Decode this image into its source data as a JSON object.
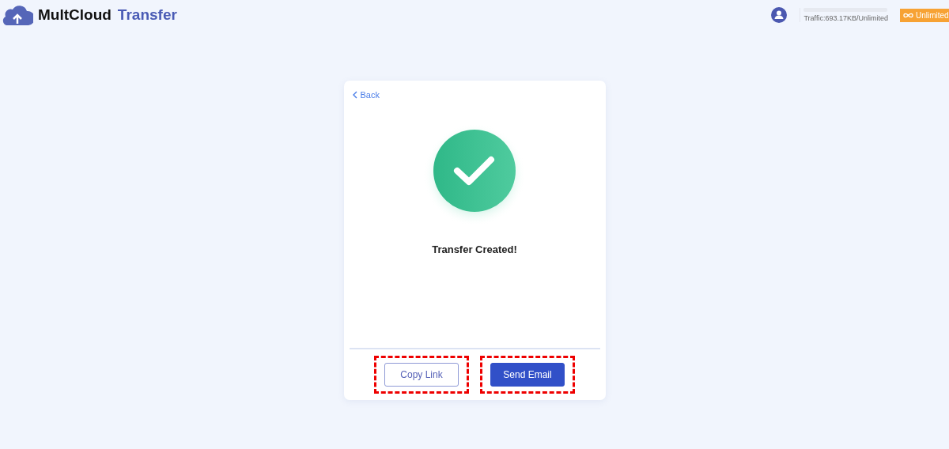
{
  "header": {
    "brand": "MultCloud",
    "product": "Transfer",
    "traffic": "Traffic:693.17KB/Unlimited",
    "plan_button": "Unlimited"
  },
  "card": {
    "back": "Back",
    "message": "Transfer Created!",
    "buttons": [
      {
        "label": "Copy Link",
        "kind": "outline",
        "highlighted": true
      },
      {
        "label": "Send Email",
        "kind": "primary",
        "highlighted": true
      }
    ]
  }
}
